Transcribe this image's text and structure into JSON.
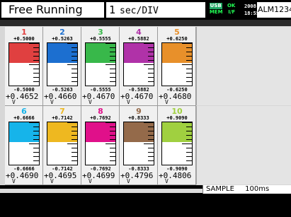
{
  "header": {
    "mode": "Free Running",
    "timebase_num": "1",
    "timebase_unit": "sec/DIV",
    "usb_label": "USB",
    "mem_label": "MEM",
    "ok_label": "OK",
    "if_label": "I/F",
    "date": "2008-01-26",
    "time": "18:55:54",
    "alm_label": "ALM",
    "alm_channels": "1234"
  },
  "channels": [
    {
      "num": "1",
      "top": "+0.5000",
      "bottom": "-0.5000",
      "value": "+0.4652",
      "unit": "V",
      "color": "#e04040",
      "num_color": "#e04040",
      "fill": 0.46
    },
    {
      "num": "2",
      "top": "+0.5263",
      "bottom": "-0.5263",
      "value": "+0.4660",
      "unit": "V",
      "color": "#1c6fd0",
      "num_color": "#1c6fd0",
      "fill": 0.46
    },
    {
      "num": "3",
      "top": "+0.5555",
      "bottom": "-0.5555",
      "value": "+0.4670",
      "unit": "V",
      "color": "#38b84a",
      "num_color": "#38b84a",
      "fill": 0.46
    },
    {
      "num": "4",
      "top": "+0.5882",
      "bottom": "-0.5882",
      "value": "+0.4670",
      "unit": "V",
      "color": "#b032a8",
      "num_color": "#b032a8",
      "fill": 0.46
    },
    {
      "num": "5",
      "top": "+0.6250",
      "bottom": "-0.6250",
      "value": "+0.4680",
      "unit": "V",
      "color": "#e8902a",
      "num_color": "#e8902a",
      "fill": 0.46
    },
    {
      "num": "6",
      "top": "+0.6666",
      "bottom": "-0.6666",
      "value": "+0.4690",
      "unit": "V",
      "color": "#16b4ea",
      "num_color": "#16b4ea",
      "fill": 0.46
    },
    {
      "num": "7",
      "top": "+0.7142",
      "bottom": "-0.7142",
      "value": "+0.4695",
      "unit": "V",
      "color": "#eeb820",
      "num_color": "#eeb820",
      "fill": 0.46
    },
    {
      "num": "8",
      "top": "+0.7692",
      "bottom": "-0.7692",
      "value": "+0.4699",
      "unit": "V",
      "color": "#e0108a",
      "num_color": "#e0108a",
      "fill": 0.46
    },
    {
      "num": "9",
      "top": "+0.8333",
      "bottom": "-0.8333",
      "value": "+0.4796",
      "unit": "V",
      "color": "#946a4a",
      "num_color": "#946a4a",
      "fill": 0.46
    },
    {
      "num": "10",
      "top": "+0.9090",
      "bottom": "-0.9090",
      "value": "+0.4806",
      "unit": "V",
      "color": "#a0d040",
      "num_color": "#a0d040",
      "fill": 0.46
    }
  ],
  "status": {
    "mode": "SAMPLE",
    "rate": "100ms"
  }
}
